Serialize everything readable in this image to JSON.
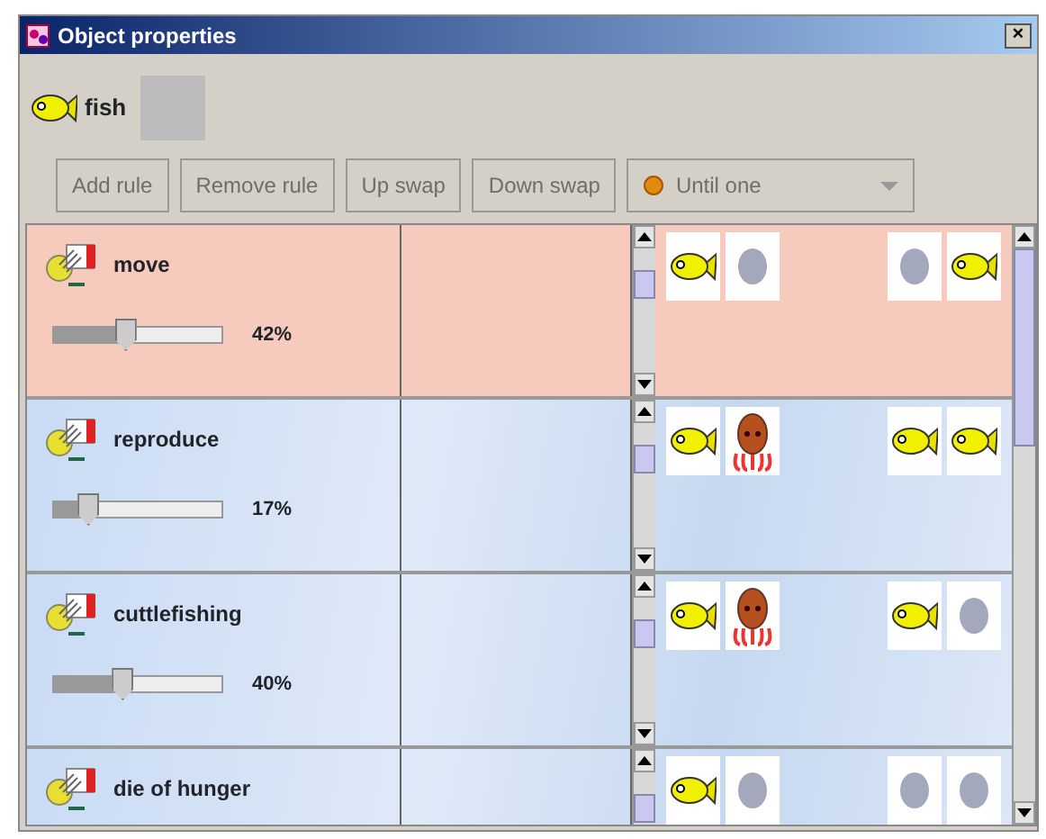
{
  "window": {
    "title": "Object properties",
    "close": "×"
  },
  "object": {
    "name": "fish"
  },
  "toolbar": {
    "buttons": [
      {
        "label": "Add rule",
        "disabled": true
      },
      {
        "label": "Remove rule",
        "disabled": true
      },
      {
        "label": "Up swap",
        "disabled": true
      },
      {
        "label": "Down swap",
        "disabled": true
      }
    ],
    "dropdown": {
      "value": "Until one",
      "disabled": true
    }
  },
  "rules": [
    {
      "name": "move",
      "selected": true,
      "level": 0.42,
      "reading": "42%",
      "before": [
        {
          "kind": "fish"
        },
        {
          "kind": "empty"
        }
      ],
      "after": [
        {
          "kind": "empty"
        },
        {
          "kind": "fish"
        }
      ]
    },
    {
      "name": "reproduce",
      "selected": false,
      "level": 0.17,
      "reading": "17%",
      "before": [
        {
          "kind": "fish"
        },
        {
          "kind": "octopus"
        }
      ],
      "after": [
        {
          "kind": "fish"
        },
        {
          "kind": "fish"
        }
      ]
    },
    {
      "name": "cuttlefishing",
      "selected": false,
      "level": 0.4,
      "reading": "40%",
      "before": [
        {
          "kind": "fish"
        },
        {
          "kind": "octopus"
        }
      ],
      "after": [
        {
          "kind": "fish"
        },
        {
          "kind": "empty"
        }
      ]
    },
    {
      "name": "die of hunger",
      "selected": false,
      "before": [
        {
          "kind": "fish"
        },
        {
          "kind": "empty"
        }
      ],
      "after": [
        {
          "kind": "empty"
        },
        {
          "kind": "empty"
        }
      ]
    }
  ]
}
